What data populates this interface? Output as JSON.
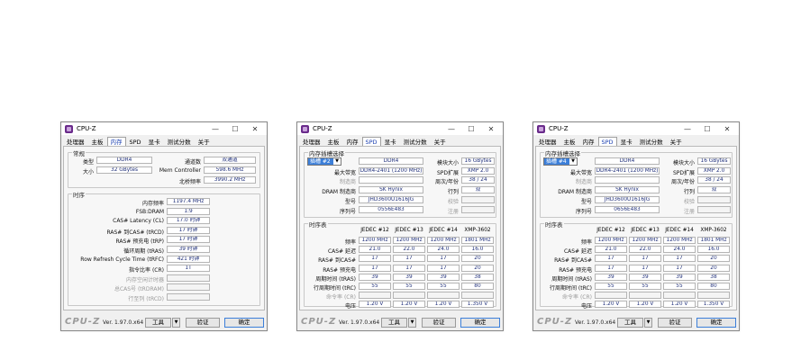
{
  "common": {
    "app_title": "CPU-Z",
    "window_buttons": {
      "minimize": "—",
      "maximize": "☐",
      "close": "✕"
    },
    "tabs": [
      "处理器",
      "主板",
      "内存",
      "SPD",
      "显卡",
      "测试分数",
      "关于"
    ],
    "footer": {
      "logo": "CPU-Z",
      "version": "Ver. 1.97.0.x64",
      "tools": "工具",
      "tools_arrow": "▼",
      "verify": "验证",
      "ok": "确定"
    }
  },
  "memory_window": {
    "active_tab": "内存",
    "general": {
      "title": "常规",
      "type_label": "类型",
      "type": "DDR4",
      "size_label": "大小",
      "size": "32 GBytes",
      "channels_label": "通道数",
      "channels": "双通道",
      "memctrl_label": "Mem Controller",
      "memctrl": "598.6 MHz",
      "nb_label": "北桥频率",
      "nb": "3990.2 MHz"
    },
    "timings": {
      "title": "时序",
      "rows": [
        {
          "label": "内存频率",
          "value": "1197.4 MHz",
          "dim": false
        },
        {
          "label": "FSB:DRAM",
          "value": "1:9",
          "dim": false
        },
        {
          "label": "CAS# Latency (CL)",
          "value": "17.0 时钟",
          "dim": false
        },
        {
          "label": "RAS# 到CAS# (tRCD)",
          "value": "17 时钟",
          "dim": false
        },
        {
          "label": "RAS# 预充电 (tRP)",
          "value": "17 时钟",
          "dim": false
        },
        {
          "label": "循环周期 (tRAS)",
          "value": "39 时钟",
          "dim": false
        },
        {
          "label": "Row Refresh Cycle Time (tRFC)",
          "value": "421 时钟",
          "dim": false
        },
        {
          "label": "指令比率 (CR)",
          "value": "1T",
          "dim": false
        },
        {
          "label": "内存空闲计时器",
          "value": "",
          "dim": true
        },
        {
          "label": "总CAS号 (tRDRAM)",
          "value": "",
          "dim": true
        },
        {
          "label": "行至列 (tRCD)",
          "value": "",
          "dim": true
        }
      ]
    }
  },
  "spd_windows": [
    {
      "slot": "插槽 #2",
      "section_title": "内存插槽选择",
      "type": "DDR4",
      "max_bw_label": "最大带宽",
      "max_bw": "DDR4-2401 (1200 MHz)",
      "mfr_label": "制造商",
      "mfr": "",
      "dram_label": "DRAM 制造商",
      "dram": "SK Hynix",
      "part_label": "型号",
      "part": "JHD3600U1616JG",
      "serial_label": "序列号",
      "serial": "0556E483",
      "size_label": "模块大小",
      "size": "16 GBytes",
      "spdext_label": "SPD扩展",
      "spdext": "XMP 2.0",
      "week_label": "周次/年份",
      "week": "38 / 24",
      "rank_label": "行列",
      "rank": "双",
      "check_label": "校验",
      "check": "",
      "reg_label": "注册",
      "reg": ""
    },
    {
      "slot": "插槽 #4",
      "section_title": "内存插槽选择",
      "type": "DDR4",
      "max_bw_label": "最大带宽",
      "max_bw": "DDR4-2401 (1200 MHz)",
      "mfr_label": "制造商",
      "mfr": "",
      "dram_label": "DRAM 制造商",
      "dram": "SK Hynix",
      "part_label": "型号",
      "part": "JHD3600U1616JG",
      "serial_label": "序列号",
      "serial": "0656E483",
      "size_label": "模块大小",
      "size": "16 GBytes",
      "spdext_label": "SPD扩展",
      "spdext": "XMP 2.0",
      "week_label": "周次/年份",
      "week": "38 / 24",
      "rank_label": "行列",
      "rank": "双",
      "check_label": "校验",
      "check": "",
      "reg_label": "注册",
      "reg": ""
    }
  ],
  "spd_timing": {
    "title": "时序表",
    "headers": [
      "JEDEC #12",
      "JEDEC #13",
      "JEDEC #14",
      "XMP-3602"
    ],
    "rows": [
      {
        "label": "频率",
        "values": [
          "1200 MHz",
          "1200 MHz",
          "1200 MHz",
          "1801 MHz"
        ],
        "dim": false
      },
      {
        "label": "CAS# 延迟",
        "values": [
          "21.0",
          "22.0",
          "24.0",
          "16.0"
        ],
        "dim": false
      },
      {
        "label": "RAS# 到CAS#",
        "values": [
          "17",
          "17",
          "17",
          "20"
        ],
        "dim": false
      },
      {
        "label": "RAS# 预充电",
        "values": [
          "17",
          "17",
          "17",
          "20"
        ],
        "dim": false
      },
      {
        "label": "周期时间 (tRAS)",
        "values": [
          "39",
          "39",
          "39",
          "38"
        ],
        "dim": false
      },
      {
        "label": "行周期时间 (tRC)",
        "values": [
          "55",
          "55",
          "55",
          "80"
        ],
        "dim": false
      },
      {
        "label": "命令率 (CR)",
        "values": [
          "",
          "",
          "",
          ""
        ],
        "dim": true
      },
      {
        "label": "电压",
        "values": [
          "1.20 V",
          "1.20 V",
          "1.20 V",
          "1.350 V"
        ],
        "dim": false
      }
    ]
  }
}
